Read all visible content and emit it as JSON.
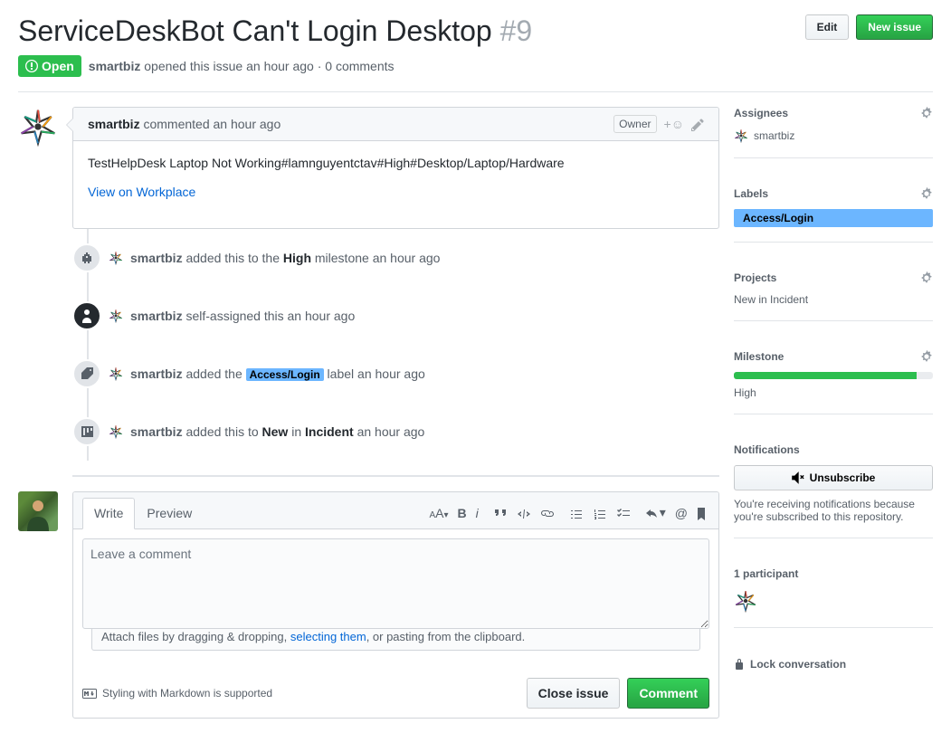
{
  "title": "ServiceDeskBot Can't Login Desktop",
  "issue_number": "#9",
  "edit_btn": "Edit",
  "new_issue_btn": "New issue",
  "state": "Open",
  "meta_author": "smartbiz",
  "meta_suffix": " opened this issue an hour ago · 0 comments",
  "comment": {
    "author": "smartbiz",
    "suffix": " commented an hour ago",
    "owner_badge": "Owner",
    "body": "TestHelpDesk Laptop Not Working#lamnguyentctav#High#Desktop/Laptop/Hardware",
    "link": "View on Workplace"
  },
  "events": {
    "milestone": {
      "author": "smartbiz",
      "pre": " added this to the ",
      "strong": "High",
      "post": " milestone an hour ago"
    },
    "assign": {
      "author": "smartbiz",
      "post": " self-assigned this an hour ago"
    },
    "label": {
      "author": "smartbiz",
      "pre": " added the ",
      "tag": "Access/Login",
      "post": " label an hour ago"
    },
    "project": {
      "author": "smartbiz",
      "pre": " added this to ",
      "strong1": "New",
      "mid": " in ",
      "strong2": "Incident",
      "post": " an hour ago"
    }
  },
  "compose": {
    "write_tab": "Write",
    "preview_tab": "Preview",
    "placeholder": "Leave a comment",
    "attach_pre": "Attach files by dragging & dropping, ",
    "attach_link": "selecting them",
    "attach_post": ", or pasting from the clipboard.",
    "md_hint": "Styling with Markdown is supported",
    "close_btn": "Close issue",
    "comment_btn": "Comment"
  },
  "sidebar": {
    "assignees_title": "Assignees",
    "assignee": "smartbiz",
    "labels_title": "Labels",
    "label": "Access/Login",
    "projects_title": "Projects",
    "project_value": "New in Incident",
    "milestone_title": "Milestone",
    "milestone_value": "High",
    "notifications_title": "Notifications",
    "unsubscribe": "Unsubscribe",
    "notif_note": "You're receiving notifications because you're subscribed to this repository.",
    "participants_title": "1 participant",
    "lock": "Lock conversation"
  }
}
